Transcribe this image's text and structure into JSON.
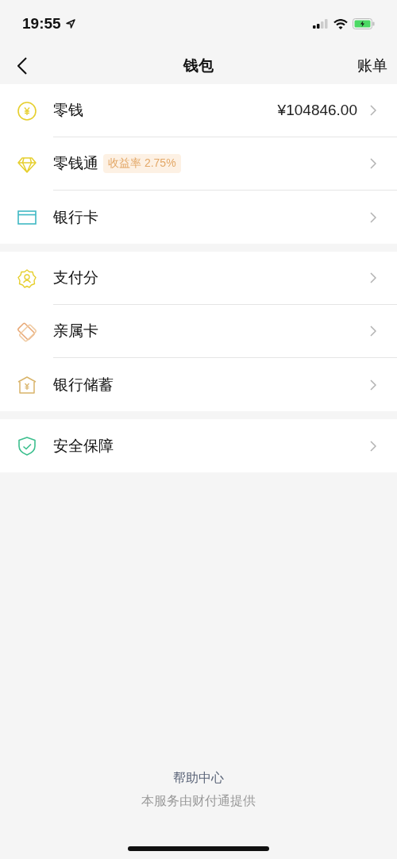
{
  "status_bar": {
    "time": "19:55"
  },
  "nav": {
    "title": "钱包",
    "action": "账单"
  },
  "groups": [
    {
      "items": [
        {
          "kind": "coin",
          "label": "零钱",
          "value": "¥104846.00"
        },
        {
          "kind": "diamond",
          "label": "零钱通",
          "badge": "收益率 2.75%"
        },
        {
          "kind": "card",
          "label": "银行卡"
        }
      ]
    },
    {
      "items": [
        {
          "kind": "score",
          "label": "支付分"
        },
        {
          "kind": "family",
          "label": "亲属卡"
        },
        {
          "kind": "bank",
          "label": "银行储蓄"
        }
      ]
    },
    {
      "items": [
        {
          "kind": "shield",
          "label": "安全保障"
        }
      ]
    }
  ],
  "footer": {
    "link": "帮助中心",
    "note": "本服务由财付通提供"
  }
}
